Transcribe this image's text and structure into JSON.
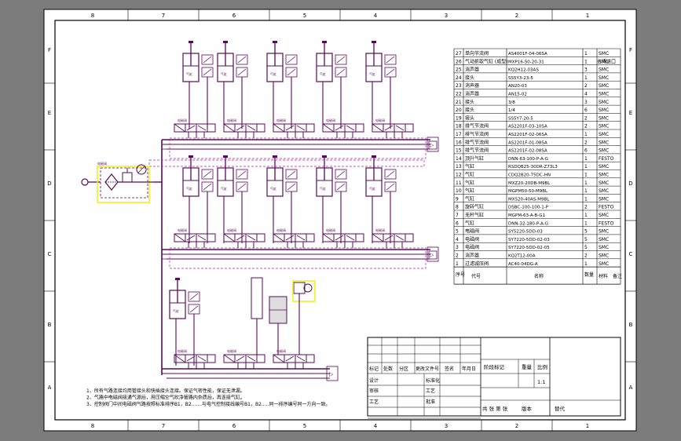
{
  "colors": {
    "background": "#7c7c7c",
    "sheet": "#ffffff",
    "frame": "#000000",
    "circuit": "#5a0a5a",
    "dashed": "#b020b0",
    "highlight": "#f0f020"
  },
  "zones": {
    "columns": [
      "8",
      "7",
      "6",
      "5",
      "4",
      "3",
      "2",
      "1"
    ],
    "rows": [
      "F",
      "E",
      "D",
      "C",
      "B",
      "A"
    ]
  },
  "bom": {
    "rows": [
      {
        "no": "27",
        "name": "单向节流阀",
        "code": "AS4001F-04-06SA",
        "qty": "1",
        "mat": "SMC",
        "note": ""
      },
      {
        "no": "26",
        "name": "气动抓取气缸 (成型)",
        "code": "MXP16-50-20-31",
        "qty": "1",
        "mat": "SMC",
        "note": "台湾进口"
      },
      {
        "no": "25",
        "name": "消声器",
        "code": "KQ2H12-03AS",
        "qty": "3",
        "mat": "SMC",
        "note": ""
      },
      {
        "no": "24",
        "name": "接头",
        "code": "SS5Y3-23-5",
        "qty": "1",
        "mat": "SMC",
        "note": ""
      },
      {
        "no": "23",
        "name": "消声器",
        "code": "AN20-03",
        "qty": "2",
        "mat": "SMC",
        "note": ""
      },
      {
        "no": "22",
        "name": "消声器",
        "code": "AN15-02",
        "qty": "4",
        "mat": "SMC",
        "note": ""
      },
      {
        "no": "21",
        "name": "接头",
        "code": "3/8",
        "qty": "3",
        "mat": "SMC",
        "note": ""
      },
      {
        "no": "20",
        "name": "接头",
        "code": "1/4",
        "qty": "6",
        "mat": "SMC",
        "note": ""
      },
      {
        "no": "19",
        "name": "接头",
        "code": "SS5Y7-20-5",
        "qty": "2",
        "mat": "SMC",
        "note": ""
      },
      {
        "no": "18",
        "name": "排气节流阀",
        "code": "AS2201F-03-10SA",
        "qty": "2",
        "mat": "SMC",
        "note": ""
      },
      {
        "no": "17",
        "name": "排气节流阀",
        "code": "AS2201F-02-06SA",
        "qty": "1",
        "mat": "SMC",
        "note": ""
      },
      {
        "no": "16",
        "name": "排气节流阀",
        "code": "AS2201F-01-08SA",
        "qty": "2",
        "mat": "SMC",
        "note": ""
      },
      {
        "no": "15",
        "name": "排气节流阀",
        "code": "AS2201F-02-08SA",
        "qty": "6",
        "mat": "SMC",
        "note": ""
      },
      {
        "no": "14",
        "name": "顶升气缸",
        "code": "DNN-63-100-P-A-G",
        "qty": "1",
        "mat": "FESTO",
        "note": ""
      },
      {
        "no": "13",
        "name": "气缸",
        "code": "RSDQB25-30DR-Z73L3",
        "qty": "1",
        "mat": "SMC",
        "note": ""
      },
      {
        "no": "12",
        "name": "气缸",
        "code": "CDQ2B20-75DC-HN",
        "qty": "1",
        "mat": "SMC",
        "note": ""
      },
      {
        "no": "11",
        "name": "气缸",
        "code": "MXZ20-20DB-M9BL",
        "qty": "1",
        "mat": "SMC",
        "note": ""
      },
      {
        "no": "10",
        "name": "气缸",
        "code": "MGPM50-50-M9BL",
        "qty": "1",
        "mat": "SMC",
        "note": ""
      },
      {
        "no": "9",
        "name": "气缸",
        "code": "MXS20-40AS-M9BL",
        "qty": "1",
        "mat": "SMC",
        "note": ""
      },
      {
        "no": "8",
        "name": "旋转气缸",
        "code": "DSBC-100-100-1-P",
        "qty": "2",
        "mat": "FESTO",
        "note": ""
      },
      {
        "no": "7",
        "name": "无杆气缸",
        "code": "MGPM-63-A-B-G1",
        "qty": "1",
        "mat": "SMC",
        "note": ""
      },
      {
        "no": "6",
        "name": "气缸",
        "code": "DNN-32-180-P-A-G",
        "qty": "1",
        "mat": "FESTO",
        "note": ""
      },
      {
        "no": "5",
        "name": "电磁阀",
        "code": "SY5220-5DD-03",
        "qty": "5",
        "mat": "SMC",
        "note": ""
      },
      {
        "no": "4",
        "name": "电磁阀",
        "code": "SY7220-5DD-02-03",
        "qty": "5",
        "mat": "SMC",
        "note": ""
      },
      {
        "no": "3",
        "name": "电磁阀",
        "code": "SY7220-5DD-02-05",
        "qty": "5",
        "mat": "SMC",
        "note": ""
      },
      {
        "no": "2",
        "name": "消声器",
        "code": "KQ2T12-00A",
        "qty": "2",
        "mat": "SMC",
        "note": ""
      },
      {
        "no": "1",
        "name": "过滤减压阀",
        "code": "AC40-04DG-A",
        "qty": "1",
        "mat": "SMC",
        "note": ""
      }
    ],
    "header": {
      "no": "序号",
      "code": "代号",
      "name": "名称",
      "qty": "数量",
      "mat": "材料",
      "note": "备注"
    }
  },
  "title_block": {
    "labels": {
      "mark": "标记",
      "count": "处数",
      "zone": "分区",
      "change_doc": "更改文件号",
      "signature": "签名",
      "date": "年月日",
      "stage_mark": "阶段标记",
      "weight": "重量",
      "scale": "比例",
      "designer": "设计",
      "standardize": "标准化",
      "checker": "审核",
      "process": "工艺",
      "approve": "批准",
      "total_sheets": "共  张 第  张",
      "version": "版本",
      "replace": "替代"
    },
    "scale_value": "1:1"
  },
  "notes": {
    "lines": [
      "1、所有气路连接均用管接头和快插接头连接。保证气密性能，保证无泄漏。",
      "2、气路中电磁阀接通气源后，用压缩空气吹净管路内杂质后，再连接气缸。",
      "3、控制阀门中间电磁阀气路按照标准排序B1，B2.......与电气控制接线编号B1，B2.....同一排序编号同一方向一致。"
    ]
  },
  "component_labels": {
    "valve": "电磁阀",
    "cylinder": "气缸"
  }
}
